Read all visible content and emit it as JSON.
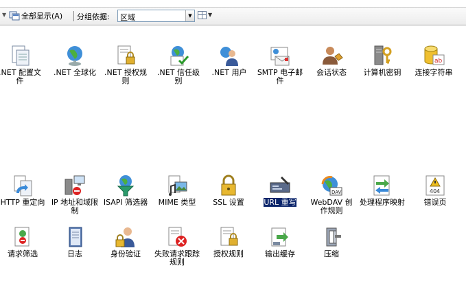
{
  "toolbar": {
    "show_all_label": "全部显示(A)",
    "group_by_label": "分组依据:",
    "group_by_value": "区域"
  },
  "features": [
    {
      "id": "net-config",
      "label": ".NET 配置文件",
      "icon": "net-config-icon"
    },
    {
      "id": "net-globalization",
      "label": ".NET 全球化",
      "icon": "globe-icon"
    },
    {
      "id": "net-authorization",
      "label": ".NET 授权规则",
      "icon": "lock-document-icon"
    },
    {
      "id": "net-trust",
      "label": ".NET 信任级别",
      "icon": "trust-check-icon"
    },
    {
      "id": "net-users",
      "label": ".NET 用户",
      "icon": "users-globe-icon"
    },
    {
      "id": "smtp",
      "label": "SMTP 电子邮件",
      "icon": "email-icon"
    },
    {
      "id": "session-state",
      "label": "会话状态",
      "icon": "session-user-icon"
    },
    {
      "id": "machine-key",
      "label": "计算机密钥",
      "icon": "machine-key-icon"
    },
    {
      "id": "conn-strings",
      "label": "连接字符串",
      "icon": "database-ab-icon"
    },
    {
      "id": "http-redirect",
      "label": "HTTP 重定向",
      "icon": "redirect-icon"
    },
    {
      "id": "ip-restrict",
      "label": "IP 地址和域限制",
      "icon": "ip-restrict-icon"
    },
    {
      "id": "isapi-filters",
      "label": "ISAPI 筛选器",
      "icon": "funnel-globe-icon"
    },
    {
      "id": "mime-types",
      "label": "MIME 类型",
      "icon": "mime-media-icon"
    },
    {
      "id": "ssl",
      "label": "SSL 设置",
      "icon": "padlock-icon"
    },
    {
      "id": "url-rewrite",
      "label": "URL 重写",
      "icon": "url-rewrite-icon"
    },
    {
      "id": "webdav",
      "label": "WebDAV 创作规则",
      "icon": "webdav-icon"
    },
    {
      "id": "handlers",
      "label": "处理程序映射",
      "icon": "handler-arrows-icon"
    },
    {
      "id": "error-pages",
      "label": "错误页",
      "icon": "error-404-icon"
    },
    {
      "id": "request-filtering",
      "label": "请求筛选",
      "icon": "request-filter-icon"
    },
    {
      "id": "logging",
      "label": "日志",
      "icon": "log-book-icon"
    },
    {
      "id": "authentication",
      "label": "身份验证",
      "icon": "auth-user-lock-icon"
    },
    {
      "id": "failed-tracing",
      "label": "失败请求跟踪规则",
      "icon": "failed-trace-icon"
    },
    {
      "id": "authz-rules",
      "label": "授权规则",
      "icon": "authz-lock-document-icon"
    },
    {
      "id": "output-cache",
      "label": "输出缓存",
      "icon": "output-cache-icon"
    },
    {
      "id": "compression",
      "label": "压缩",
      "icon": "compression-clamp-icon"
    }
  ]
}
